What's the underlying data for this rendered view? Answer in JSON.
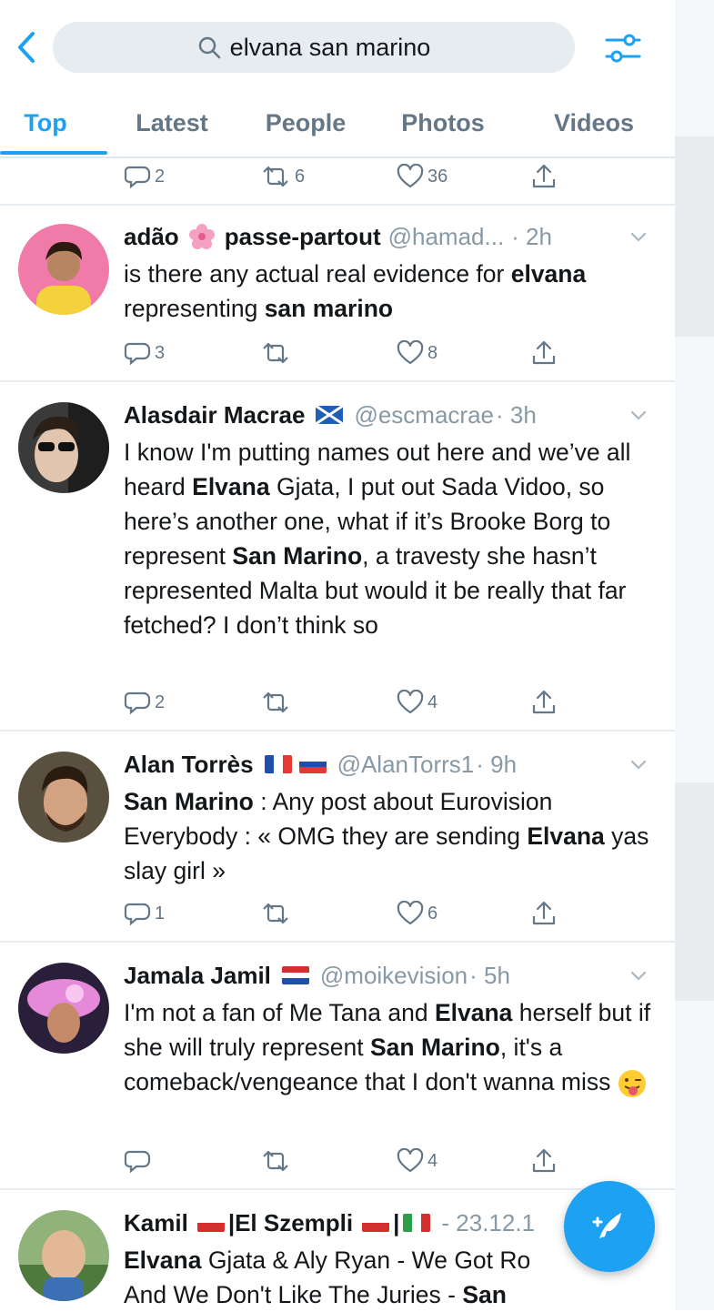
{
  "header": {
    "search_query": "elvana san marino"
  },
  "tabs": [
    {
      "label": "Top",
      "active": true
    },
    {
      "label": "Latest",
      "active": false
    },
    {
      "label": "People",
      "active": false
    },
    {
      "label": "Photos",
      "active": false
    },
    {
      "label": "Videos",
      "active": false
    }
  ],
  "partial_row": {
    "replies": "2",
    "retweets": "6",
    "likes": "36"
  },
  "tweets": [
    {
      "name": "adão",
      "name2": "passe-partout",
      "handle": "@hamad...",
      "time": "· 2h",
      "text_segments": [
        {
          "t": "is there any actual real evidence for ",
          "b": false
        },
        {
          "t": "elvana",
          "b": true
        },
        {
          "t": " representing ",
          "b": false
        },
        {
          "t": "san marino",
          "b": true
        }
      ],
      "replies": "3",
      "retweets": "",
      "likes": "8"
    },
    {
      "name": "Alasdair Macrae",
      "handle": "@escmacrae",
      "time": "· 3h",
      "text_segments": [
        {
          "t": "I know I'm putting names out here and we’ve all heard ",
          "b": false
        },
        {
          "t": "Elvana",
          "b": true
        },
        {
          "t": " Gjata, I put out Sada Vidoo, so here’s another one, what if it’s Brooke Borg to represent ",
          "b": false
        },
        {
          "t": "San Marino",
          "b": true
        },
        {
          "t": ", a travesty she hasn’t represented Malta but would it be really that far fetched? I don’t think so",
          "b": false
        }
      ],
      "replies": "2",
      "retweets": "",
      "likes": "4"
    },
    {
      "name": "Alan Torrès",
      "handle": "@AlanTorrs1",
      "time": "· 9h",
      "text_segments": [
        {
          "t": "San Marino",
          "b": true
        },
        {
          "t": " : Any post about Eurovision Everybody : « OMG they are sending ",
          "b": false
        },
        {
          "t": "Elvana",
          "b": true
        },
        {
          "t": " yas slay girl »",
          "b": false
        }
      ],
      "replies": "1",
      "retweets": "",
      "likes": "6"
    },
    {
      "name": "Jamala Jamil",
      "handle": "@moikevision",
      "time": "· 5h",
      "text_segments": [
        {
          "t": "I'm not a fan of Me Tana and ",
          "b": false
        },
        {
          "t": "Elvana",
          "b": true
        },
        {
          "t": " herself but if she will truly represent ",
          "b": false
        },
        {
          "t": "San Marino",
          "b": true
        },
        {
          "t": ", it's a comeback/vengeance that I don't wanna miss",
          "b": false
        }
      ],
      "replies": "",
      "retweets": "",
      "likes": "4"
    },
    {
      "name": "Kamil",
      "name2": "|El Szempli",
      "name3": "|",
      "time": "- 23.12.1",
      "text_segments": [
        {
          "t": "Elvana",
          "b": true
        },
        {
          "t": " Gjata & Aly Ryan - We Got Ro",
          "b": false
        },
        {
          "t": " And We Don't Like The Juries - ",
          "b": false
        },
        {
          "t": "San",
          "b": true
        }
      ]
    }
  ],
  "colors": {
    "accent": "#1da1f2",
    "text": "#14171a",
    "muted": "#657786",
    "divider": "#e6ecf0"
  },
  "icons": [
    "back-arrow-icon",
    "search-icon",
    "filter-icon",
    "reply-icon",
    "retweet-icon",
    "like-icon",
    "share-icon",
    "chevron-down-icon",
    "compose-icon"
  ]
}
